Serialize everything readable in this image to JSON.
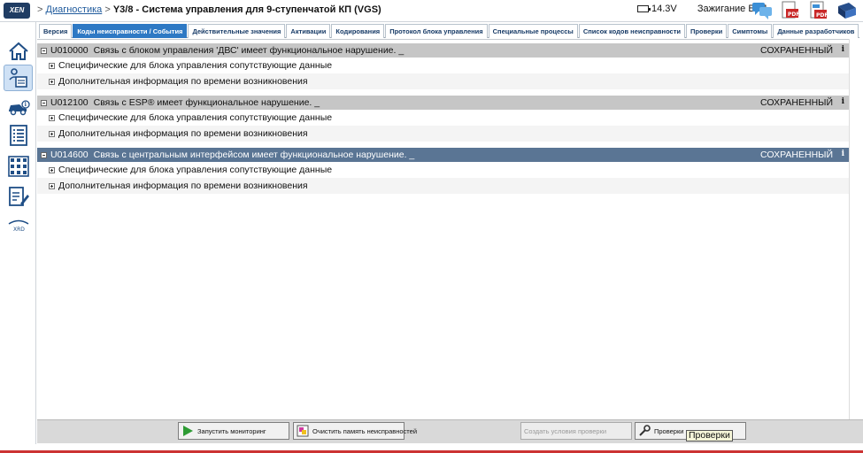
{
  "header": {
    "logo_text": "XEN",
    "breadcrumb_prefix": ">",
    "breadcrumb_link": "Диагностика",
    "breadcrumb_separator": ">",
    "breadcrumb_current": "Y3/8 - Система управления для 9-ступенчатой КП (VGS)",
    "voltage": "14.3V",
    "ignition": "Зажигание ВКЛ"
  },
  "sidebar": {
    "items": [
      {
        "name": "home",
        "icon": "home-icon"
      },
      {
        "name": "diagnosis",
        "icon": "diagnosis-icon",
        "active": true
      },
      {
        "name": "vehicle",
        "icon": "car-info-icon"
      },
      {
        "name": "list",
        "icon": "list-icon"
      },
      {
        "name": "grid",
        "icon": "grid-icon"
      },
      {
        "name": "document",
        "icon": "document-edit-icon"
      },
      {
        "name": "xrd",
        "icon": "xrd-icon",
        "label": "XRD"
      }
    ]
  },
  "tabs": [
    {
      "label": "Версия",
      "active": false
    },
    {
      "label": "Коды неисправности / События",
      "active": true
    },
    {
      "label": "Действительные значения",
      "active": false
    },
    {
      "label": "Активации",
      "active": false
    },
    {
      "label": "Кодирования",
      "active": false
    },
    {
      "label": "Протокол блока управления",
      "active": false
    },
    {
      "label": "Специальные процессы",
      "active": false
    },
    {
      "label": "Список кодов неисправности",
      "active": false
    },
    {
      "label": "Проверки",
      "active": false
    },
    {
      "label": "Симптомы",
      "active": false
    },
    {
      "label": "Данные разработчиков",
      "active": false
    }
  ],
  "faults": [
    {
      "code": "U010000",
      "text": "Связь с блоком управления 'ДВС' имеет функциональное нарушение. _",
      "status": "СОХРАНЕННЫЙ",
      "selected": false,
      "rows": [
        "Специфические для блока управления сопутствующие данные",
        "Дополнительная информация по времени возникновения"
      ]
    },
    {
      "code": "U012100",
      "text": "Связь с ESP® имеет функциональное нарушение. _",
      "status": "СОХРАНЕННЫЙ",
      "selected": false,
      "rows": [
        "Специфические для блока управления сопутствующие данные",
        "Дополнительная информация по времени возникновения"
      ]
    },
    {
      "code": "U014600",
      "text": "Связь с центральным интерфейсом имеет функциональное нарушение. _",
      "status": "СОХРАНЕННЫЙ",
      "selected": true,
      "rows": [
        "Специфические для блока управления сопутствующие данные",
        "Дополнительная информация по времени возникновения"
      ]
    }
  ],
  "info_symbol": "i",
  "toolbar": {
    "start_monitoring": "Запустить мониторинг",
    "clear_memory": "Очистить память неисправностей",
    "create_conditions": "Создать условия проверки",
    "checks": "Проверки",
    "tooltip": "Проверки"
  },
  "colors": {
    "selected_header": "#5a7594",
    "header": "#c6c6c6",
    "active_tab": "#2e79c4"
  }
}
